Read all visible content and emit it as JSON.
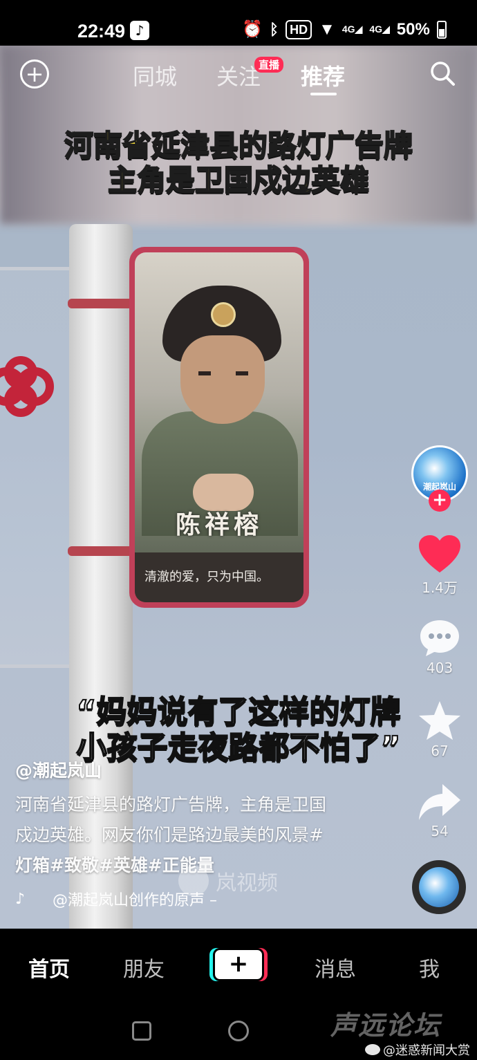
{
  "status_bar": {
    "time": "22:49",
    "app_icon": "tiktok-icon",
    "hd": "HD",
    "signal_1": "4G",
    "signal_2": "4G",
    "battery": "50%"
  },
  "top_nav": {
    "tabs": [
      {
        "label": "同城",
        "active": false
      },
      {
        "label": "关注",
        "active": false
      },
      {
        "label": "推荐",
        "active": true
      }
    ],
    "live_badge": "直播"
  },
  "video": {
    "caption_top_line1": "河南省延津县的路灯广告牌",
    "caption_top_line2": "主角是卫国戍边英雄",
    "sign_name": "陈祥榕",
    "sign_slogan": "清澈的爱，只为中国。",
    "quote_line1": "“妈妈说有了这样的灯牌",
    "quote_line2": "小孩子走夜路都不怕了”",
    "watermark": "岚视频"
  },
  "right_rail": {
    "avatar_text": "潮起岚山",
    "likes": "1.4万",
    "comments": "403",
    "favorites": "67",
    "shares": "54"
  },
  "post": {
    "author": "@潮起岚山",
    "description_line1": "河南省延津县的路灯广告牌，主角是卫国",
    "description_line2": "戍边英雄。网友你们是路边最美的风景#",
    "tags": "灯箱#致敬#英雄#正能量",
    "music": "@潮起岚山创作的原声 –"
  },
  "tab_bar": {
    "items": [
      {
        "label": "首页",
        "active": true
      },
      {
        "label": "朋友",
        "active": false
      },
      {
        "label": "消息",
        "active": false
      },
      {
        "label": "我",
        "active": false
      }
    ]
  },
  "overlays": {
    "forum_watermark": "声远论坛",
    "weibo_watermark": "@迷惑新闻大赏"
  },
  "colors": {
    "accent_red": "#fe2c55",
    "accent_cyan": "#25f4ee",
    "caption_yellow": "#ffe43a"
  }
}
